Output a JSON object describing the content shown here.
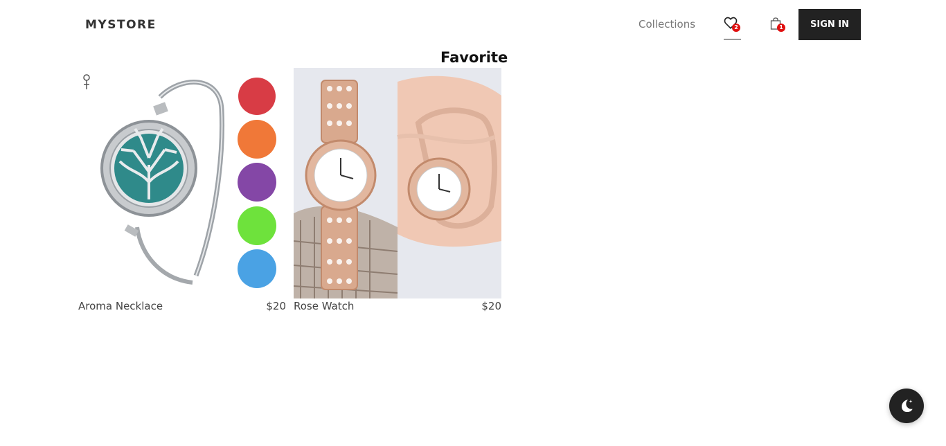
{
  "header": {
    "logo": "MYSTORE",
    "nav": {
      "collections": "Collections"
    },
    "favorites": {
      "icon": "heart-icon",
      "count": "2"
    },
    "cart": {
      "icon": "shopping-bag-icon",
      "count": "1"
    },
    "signin_label": "SIGN IN"
  },
  "page": {
    "title": "Favorite"
  },
  "products": [
    {
      "name": "Aroma Necklace",
      "price": "$20",
      "image": "aroma-necklace-image"
    },
    {
      "name": "Rose Watch",
      "price": "$20",
      "image": "rose-watch-image"
    }
  ],
  "dark_mode_toggle": {
    "icon": "moon-icon"
  },
  "colors": {
    "primary": "#222222",
    "badge": "#e01010",
    "muted_text": "#777777"
  }
}
